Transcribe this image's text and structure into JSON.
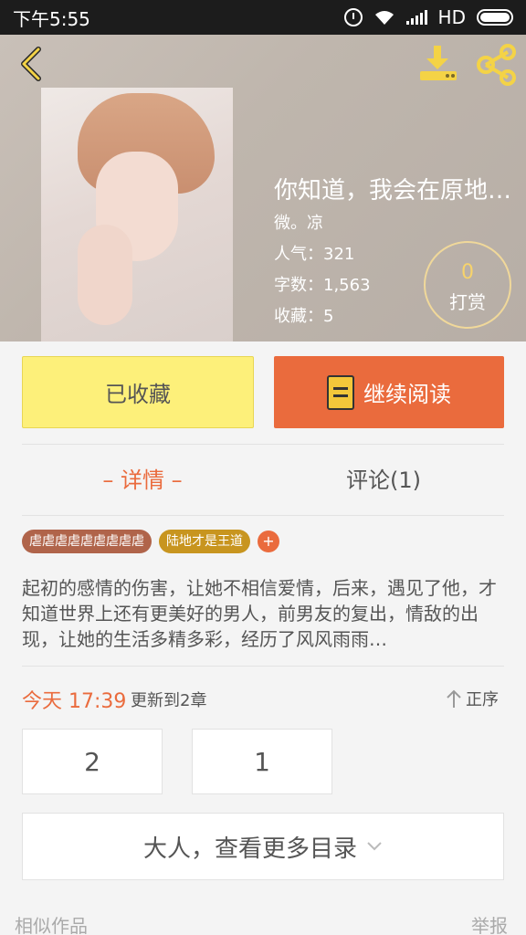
{
  "status_bar": {
    "time": "下午5:55",
    "network": "HD"
  },
  "header": {
    "title": "你知道，我会在原地…",
    "author": "微。凉",
    "popularity": "人气：321",
    "word_count": "字数：1,563",
    "favorites": "收藏：5",
    "tip": {
      "count": "0",
      "label": "打赏"
    }
  },
  "actions": {
    "collected_label": "已收藏",
    "continue_label": "继续阅读"
  },
  "tabs": {
    "detail": "– 详情 –",
    "comments": "评论(1)"
  },
  "tags": [
    "虐虐虐虐虐虐虐虐虐",
    "陆地才是王道"
  ],
  "tag_add": "+",
  "description": "起初的感情的伤害，让她不相信爱情，后来，遇见了他，才知道世界上还有更美好的男人，前男友的复出，情敌的出现，让她的生活多精多彩，经历了风风雨雨…",
  "update": {
    "time": "今天 17:39",
    "text": "更新到2章",
    "sort_label": "正序"
  },
  "chapters": [
    "2",
    "1"
  ],
  "more_label": "大人，查看更多目录",
  "footer": {
    "similar": "相似作品",
    "report": "举报"
  },
  "colors": {
    "accent": "#ea6b3d",
    "collected_bg": "#fdf07a",
    "status_bar": "#1c1c1c"
  },
  "icons": [
    "back-arrow-icon",
    "download-icon",
    "share-icon",
    "book-icon",
    "up-arrow-icon",
    "chevron-down-icon"
  ]
}
